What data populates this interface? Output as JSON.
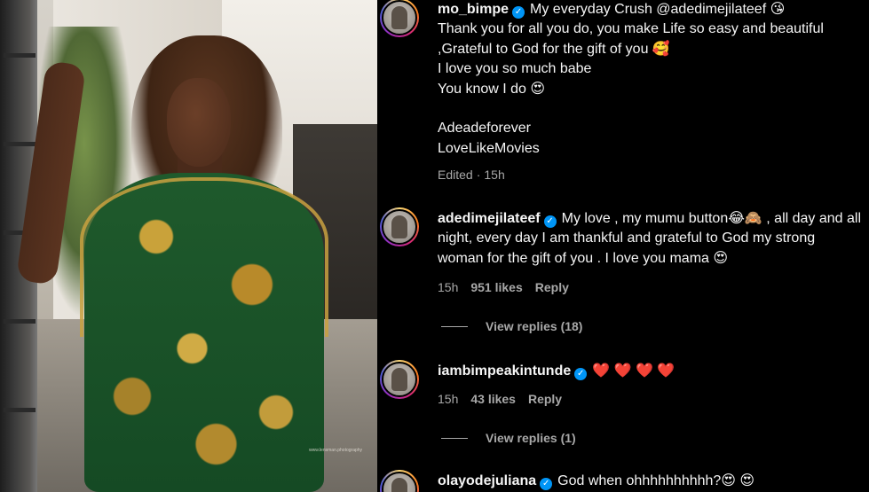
{
  "photo": {
    "watermark": "www.lensman.photography"
  },
  "comments": [
    {
      "username": "mo_bimpe",
      "lines": [
        "My everyday Crush @adedimejilateef 😘",
        "Thank you for all you do, you make Life so easy and beautiful",
        ",Grateful to God for the gift of you 🥰",
        "I love you so much babe",
        "You know I do 😍",
        "",
        "Adeadeforever",
        "LoveLikeMovies"
      ],
      "edited": "Edited",
      "time": "15h"
    },
    {
      "username": "adedimejilateef",
      "text": "My love , my mumu button😂🙈 , all day and all night, every day I am thankful and grateful to God my strong woman for the gift of you . I love you mama 😍",
      "time": "15h",
      "likes": "951 likes",
      "reply": "Reply",
      "view_replies": "View replies (18)"
    },
    {
      "username": "iambimpeakintunde",
      "text": "❤️ ❤️ ❤️ ❤️",
      "time": "15h",
      "likes": "43 likes",
      "reply": "Reply",
      "view_replies": "View replies (1)"
    },
    {
      "username": "olayodejuliana",
      "text": "God when ohhhhhhhhhh?😍 😍"
    }
  ],
  "colors": {
    "background": "#000000",
    "text": "#f5f5f5",
    "muted": "#a8a8a8",
    "verified": "#0095f6"
  }
}
